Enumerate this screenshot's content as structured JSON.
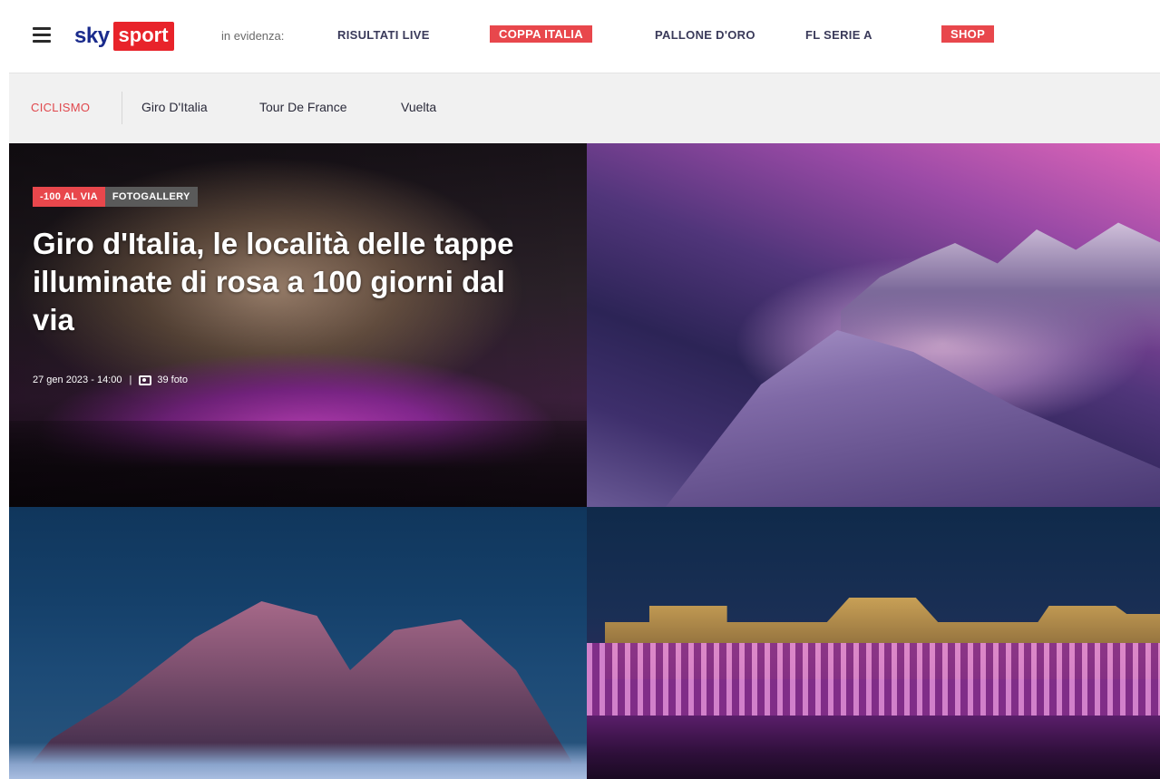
{
  "header": {
    "logo_sky": "sky",
    "logo_sport": "sport",
    "evidenza_label": "in evidenza:",
    "nav": [
      {
        "label": "RISULTATI LIVE"
      },
      {
        "label": "COPPA ITALIA"
      },
      {
        "label": "PALLONE D'ORO"
      },
      {
        "label": "FL SERIE A"
      },
      {
        "label": "SHOP"
      }
    ]
  },
  "subnav": {
    "section": "CICLISMO",
    "links": [
      "Giro D'Italia",
      "Tour De France",
      "Vuelta"
    ]
  },
  "feature": {
    "tag_primary": "-100 AL VIA",
    "tag_secondary": "FOTOGALLERY",
    "headline": "Giro d'Italia, le località delle tappe illuminate di rosa a 100 giorni dal via",
    "date": "27 gen 2023 - 14:00",
    "photo_count": "39 foto"
  },
  "colors": {
    "brand_red": "#e8232a",
    "sky_blue": "#1a2b8c",
    "tag_red": "#e8474c"
  }
}
